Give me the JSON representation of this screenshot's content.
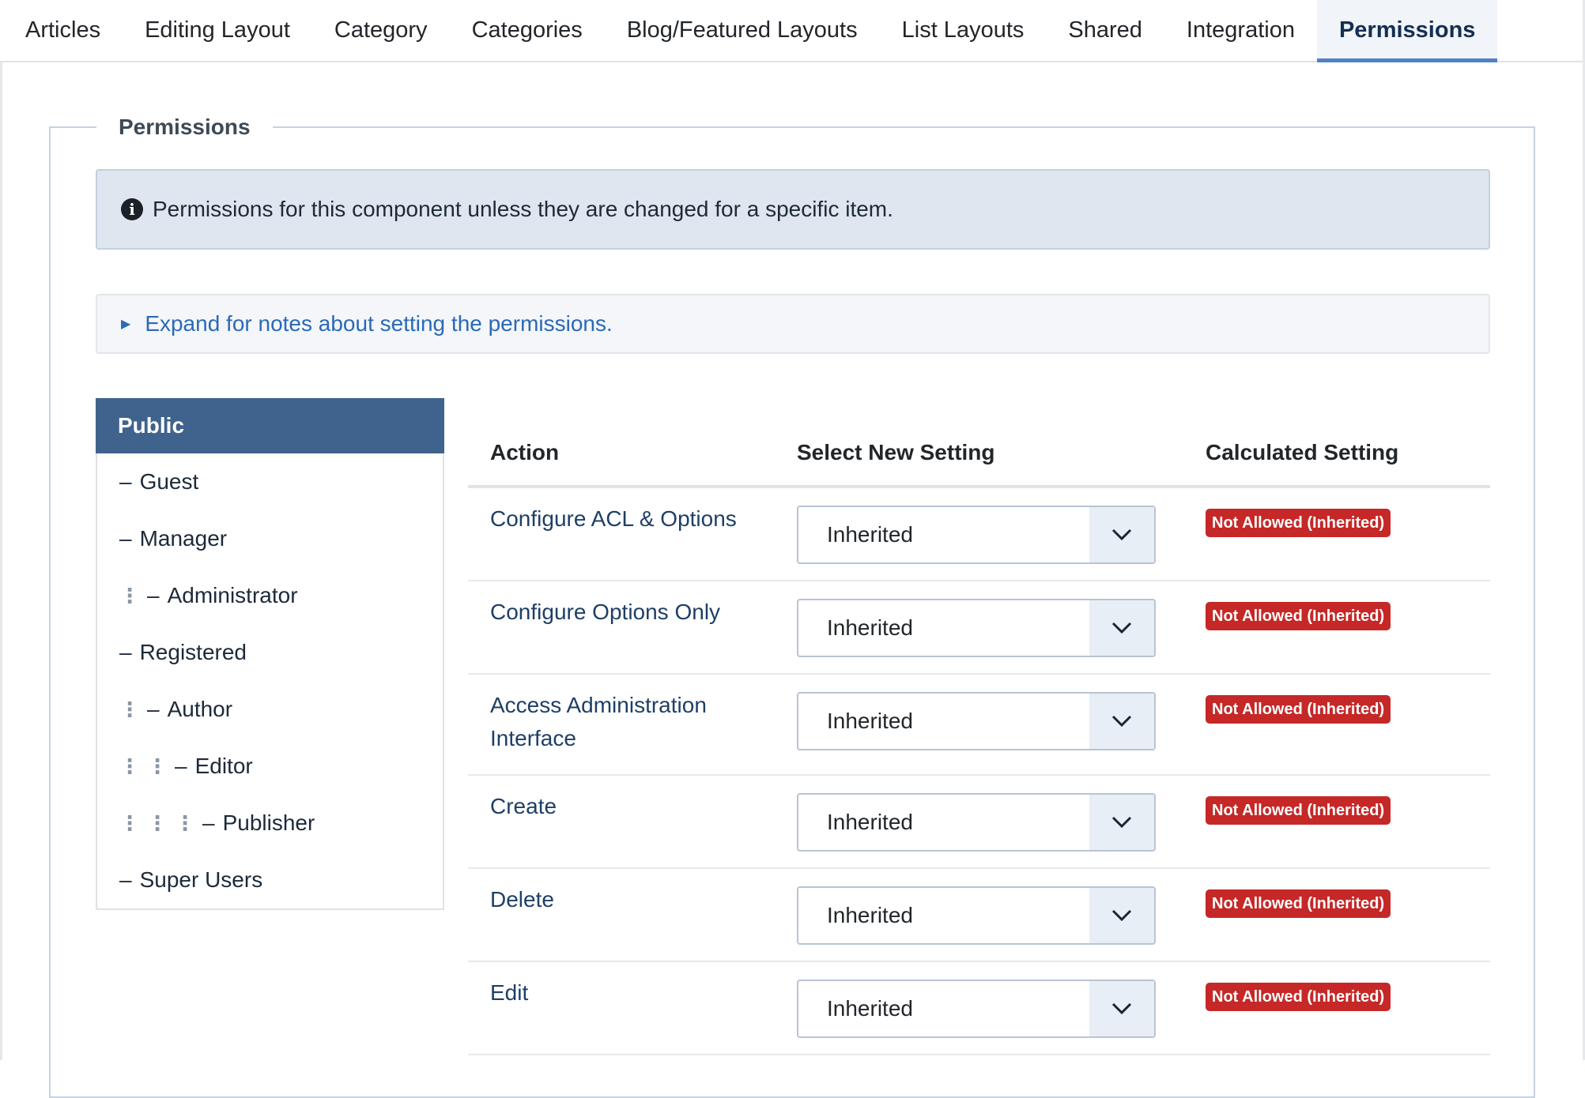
{
  "tabs": [
    {
      "label": "Articles",
      "active": false
    },
    {
      "label": "Editing Layout",
      "active": false
    },
    {
      "label": "Category",
      "active": false
    },
    {
      "label": "Categories",
      "active": false
    },
    {
      "label": "Blog/Featured Layouts",
      "active": false
    },
    {
      "label": "List Layouts",
      "active": false
    },
    {
      "label": "Shared",
      "active": false
    },
    {
      "label": "Integration",
      "active": false
    },
    {
      "label": "Permissions",
      "active": true
    }
  ],
  "fieldset": {
    "legend": "Permissions"
  },
  "info_alert": {
    "icon": "info-circle-icon",
    "text": "Permissions for this component unless they are changed for a specific item."
  },
  "notes": {
    "icon": "triangle-right-icon",
    "label": "Expand for notes about setting the permissions."
  },
  "groups": {
    "active": "Public",
    "items": [
      {
        "label": "Guest",
        "depth": 0
      },
      {
        "label": "Manager",
        "depth": 0
      },
      {
        "label": "Administrator",
        "depth": 1
      },
      {
        "label": "Registered",
        "depth": 0
      },
      {
        "label": "Author",
        "depth": 1
      },
      {
        "label": "Editor",
        "depth": 2
      },
      {
        "label": "Publisher",
        "depth": 3
      },
      {
        "label": "Super Users",
        "depth": 0
      }
    ]
  },
  "table": {
    "headers": {
      "action": "Action",
      "select": "Select New Setting",
      "calculated": "Calculated Setting"
    },
    "rows": [
      {
        "action": "Configure ACL & Options",
        "select": "Inherited",
        "calculated": "Not Allowed (Inherited)"
      },
      {
        "action": "Configure Options Only",
        "select": "Inherited",
        "calculated": "Not Allowed (Inherited)"
      },
      {
        "action": "Access Administration Interface",
        "select": "Inherited",
        "calculated": "Not Allowed (Inherited)"
      },
      {
        "action": "Create",
        "select": "Inherited",
        "calculated": "Not Allowed (Inherited)"
      },
      {
        "action": "Delete",
        "select": "Inherited",
        "calculated": "Not Allowed (Inherited)"
      },
      {
        "action": "Edit",
        "select": "Inherited",
        "calculated": "Not Allowed (Inherited)"
      }
    ]
  },
  "colors": {
    "active_group_bg": "#3f638c",
    "tab_underline": "#4f82c3",
    "badge_danger": "#c52827",
    "link": "#2a69b8"
  }
}
